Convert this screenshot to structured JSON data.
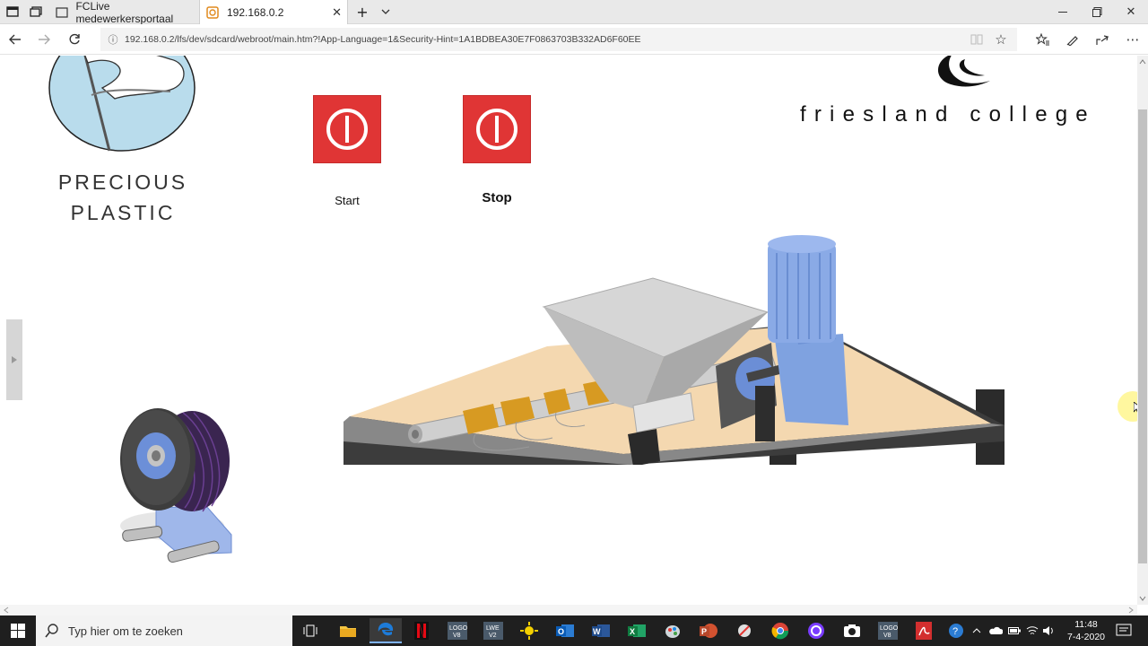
{
  "browser": {
    "tabs": [
      {
        "title": "FCLive medewerkersportaal",
        "active": false
      },
      {
        "title": "192.168.0.2",
        "active": true
      }
    ],
    "url": "192.168.0.2/lfs/dev/sdcard/webroot/main.htm?!App-Language=1&Security-Hint=1A1BDBEA30E7F0863703B332AD6F60EE"
  },
  "page": {
    "logo_left": {
      "line1": "PRECIOUS",
      "line2": "PLASTIC"
    },
    "logo_right": {
      "text": "friesland college"
    },
    "start_button": {
      "label": "Start"
    },
    "stop_button": {
      "label": "Stop"
    },
    "colors": {
      "button_red": "#e03535",
      "hopper_gray": "#bdbdbd",
      "table_top": "#f4d8b0",
      "motor_blue": "#7fa2e0",
      "heater_band": "#d79a22"
    }
  },
  "taskbar": {
    "search_placeholder": "Typ hier om te zoeken",
    "time": "11:48",
    "date": "7-4-2020",
    "apps": [
      "task-view",
      "file-explorer",
      "edge",
      "netflix",
      "logo-v8",
      "lwe-v2",
      "sun-app",
      "outlook",
      "word",
      "excel",
      "paint",
      "powerpoint",
      "snip",
      "chrome",
      "obs",
      "camera",
      "logo-v8-2",
      "acrobat"
    ]
  }
}
